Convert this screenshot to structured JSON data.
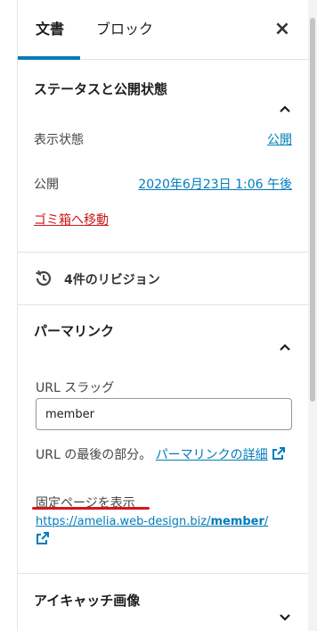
{
  "tabs": {
    "document": "文書",
    "block": "ブロック",
    "close_icon": "×"
  },
  "status": {
    "title": "ステータスと公開状態",
    "visibility_label": "表示状態",
    "visibility_value": "公開",
    "publish_label": "公開",
    "publish_value": "2020年6月23日 1:06 午後",
    "trash": "ゴミ箱へ移動"
  },
  "revisions": {
    "text": "4件のリビジョン"
  },
  "permalink": {
    "title": "パーマリンク",
    "slug_label": "URL スラッグ",
    "slug_value": "member",
    "help_text": "URL の最後の部分。",
    "help_link": "パーマリンクの詳細",
    "view_label": "固定ページを表示",
    "url_base": "https://amelia.web-design.biz/",
    "url_slug": "member",
    "url_suffix": "/"
  },
  "featured": {
    "title": "アイキャッチ画像"
  },
  "colors": {
    "accent": "#007cba",
    "danger": "#cc1818",
    "annotation": "#d01818"
  }
}
